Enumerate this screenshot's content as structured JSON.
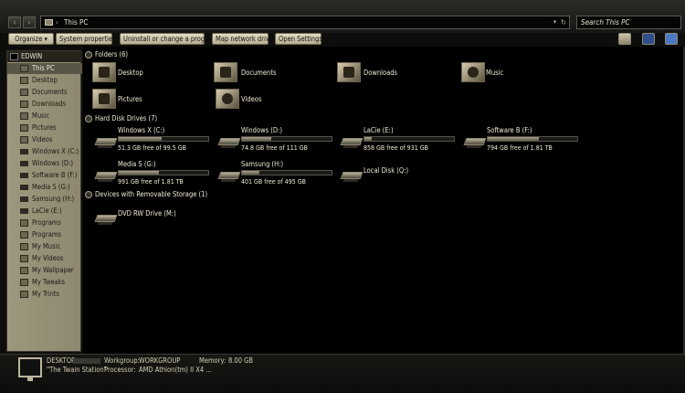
{
  "window": {
    "address": "This PC",
    "search_placeholder": "Search This PC"
  },
  "toolbar": {
    "organize": "Organize  ▾",
    "system_properties": "System properties",
    "uninstall": "Uninstall or change a program",
    "map_drive": "Map network drive",
    "open_settings": "Open Settings"
  },
  "sidebar": {
    "items": [
      "EDWIN",
      "This PC",
      "Desktop",
      "Documents",
      "Downloads",
      "Music",
      "Pictures",
      "Videos",
      "Windows X (C:)",
      "Windows (D:)",
      "Software B (F:)",
      "Media S (G:)",
      "Samsung (H:)",
      "LaCie (E:)",
      "Programs",
      "Programs",
      "My Music",
      "My Videos",
      "My Wallpaper",
      "My Tweaks",
      "My Trints"
    ]
  },
  "groups": {
    "folders": "Folders (6)",
    "drives": "Hard Disk Drives (7)",
    "removable": "Devices with Removable Storage (1)"
  },
  "folders": [
    "Desktop",
    "Documents",
    "Downloads",
    "Music",
    "Pictures",
    "Videos"
  ],
  "drives": [
    {
      "name": "Windows X (C:)",
      "free": "51.3 GB free of 99.5 GB",
      "used": 0.48
    },
    {
      "name": "Windows (D:)",
      "free": "74.8 GB free of 111 GB",
      "used": 0.33
    },
    {
      "name": "LaCie (E:)",
      "free": "858 GB free of 931 GB",
      "used": 0.08
    },
    {
      "name": "Software B (F:)",
      "free": "794 GB free of 1.81 TB",
      "used": 0.57
    },
    {
      "name": "Media S (G:)",
      "free": "991 GB free of 1.81 TB",
      "used": 0.45
    },
    {
      "name": "Samsung (H:)",
      "free": "401 GB free of 495 GB",
      "used": 0.19
    },
    {
      "name": "Local Disk (Q:)",
      "free": "",
      "used": 0
    }
  ],
  "removable": [
    "DVD RW Drive (M:)"
  ],
  "details": {
    "computer_name": "DESKTOP",
    "description": "\"The Twain Station\"",
    "workgroup_label": "Workgroup:",
    "workgroup_value": "WORKGROUP",
    "processor_label": "Processor:",
    "processor_value": "AMD Athlon(tm) II X4 ...",
    "memory_label": "Memory:",
    "memory_value": "8.00 GB"
  }
}
